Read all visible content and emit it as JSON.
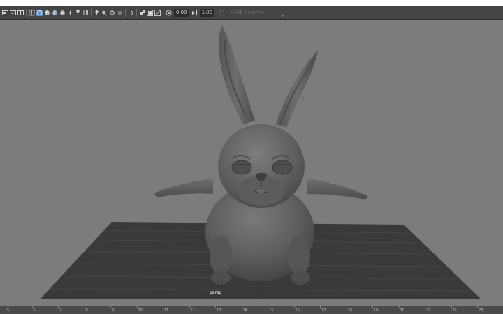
{
  "toolbar": {
    "exposure_value": "0.00",
    "gamma_value": "1.00",
    "color_space_label": "sRGB gamma",
    "icons": [
      "camera-attributes-icon",
      "bookmarks-icon",
      "image-plane-icon",
      "grid-icon",
      "wireframe-icon",
      "smooth-shade-icon",
      "textured-icon",
      "lighting-icon",
      "shadows-icon",
      "xray-icon",
      "isolate-select-icon",
      "xray-joints-icon",
      "ambient-occlusion-icon",
      "motion-blur-icon",
      "multisample-aa-icon",
      "depth-of-field-icon",
      "film-gate-icon",
      "resolution-gate-icon",
      "gate-mask-icon",
      "field-chart-icon",
      "exposure-icon",
      "gamma-icon",
      "color-management-icon"
    ]
  },
  "viewport": {
    "camera_name": "persp",
    "background_color": "#7c7c7c",
    "ground_color": "#3a3a3a",
    "character_color": "#5e5e5e"
  },
  "timeslider": {
    "ticks": [
      "5",
      "6",
      "7",
      "8",
      "9",
      "10",
      "11",
      "12",
      "13",
      "14",
      "15",
      "16",
      "17",
      "18",
      "19",
      "20",
      "21",
      "22",
      "23"
    ]
  }
}
